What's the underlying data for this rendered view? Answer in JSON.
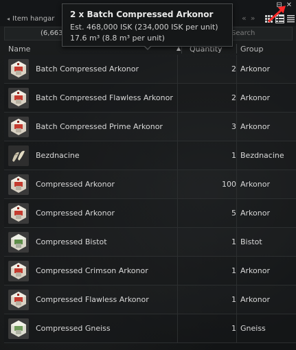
{
  "window": {
    "tab_label": "Item hangar",
    "stats_value": "(6,663",
    "search_placeholder": "Search",
    "nav_back": "«",
    "nav_forward": "»"
  },
  "tooltip": {
    "title": "2 x Batch Compressed Arkonor",
    "estimate": "Est. 468,000 ISK (234,000 ISK per unit)",
    "volume": "17.6 m³ (8.8 m³ per unit)"
  },
  "columns": {
    "name": "Name",
    "quantity": "Quantity",
    "group": "Group"
  },
  "rows": [
    {
      "name": "Batch Compressed Arkonor",
      "qty": "2",
      "group": "Arkonor",
      "icon": "arkonor-icon"
    },
    {
      "name": "Batch Compressed Flawless Arkonor",
      "qty": "2",
      "group": "Arkonor",
      "icon": "arkonor-icon"
    },
    {
      "name": "Batch Compressed Prime Arkonor",
      "qty": "3",
      "group": "Arkonor",
      "icon": "arkonor-icon"
    },
    {
      "name": "Bezdnacine",
      "qty": "1",
      "group": "Bezdnacine",
      "icon": "bezdnacine-icon"
    },
    {
      "name": "Compressed Arkonor",
      "qty": "100",
      "group": "Arkonor",
      "icon": "arkonor-icon"
    },
    {
      "name": "Compressed Arkonor",
      "qty": "5",
      "group": "Arkonor",
      "icon": "arkonor-icon"
    },
    {
      "name": "Compressed Bistot",
      "qty": "1",
      "group": "Bistot",
      "icon": "bistot-icon"
    },
    {
      "name": "Compressed Crimson Arkonor",
      "qty": "1",
      "group": "Arkonor",
      "icon": "arkonor-icon"
    },
    {
      "name": "Compressed Flawless Arkonor",
      "qty": "1",
      "group": "Arkonor",
      "icon": "arkonor-icon"
    },
    {
      "name": "Compressed Gneiss",
      "qty": "1",
      "group": "Gneiss",
      "icon": "gneiss-icon"
    }
  ],
  "colors": {
    "accent_arrow": "#ff2a2a",
    "text": "#d9d9d9",
    "panel": "#151718"
  }
}
